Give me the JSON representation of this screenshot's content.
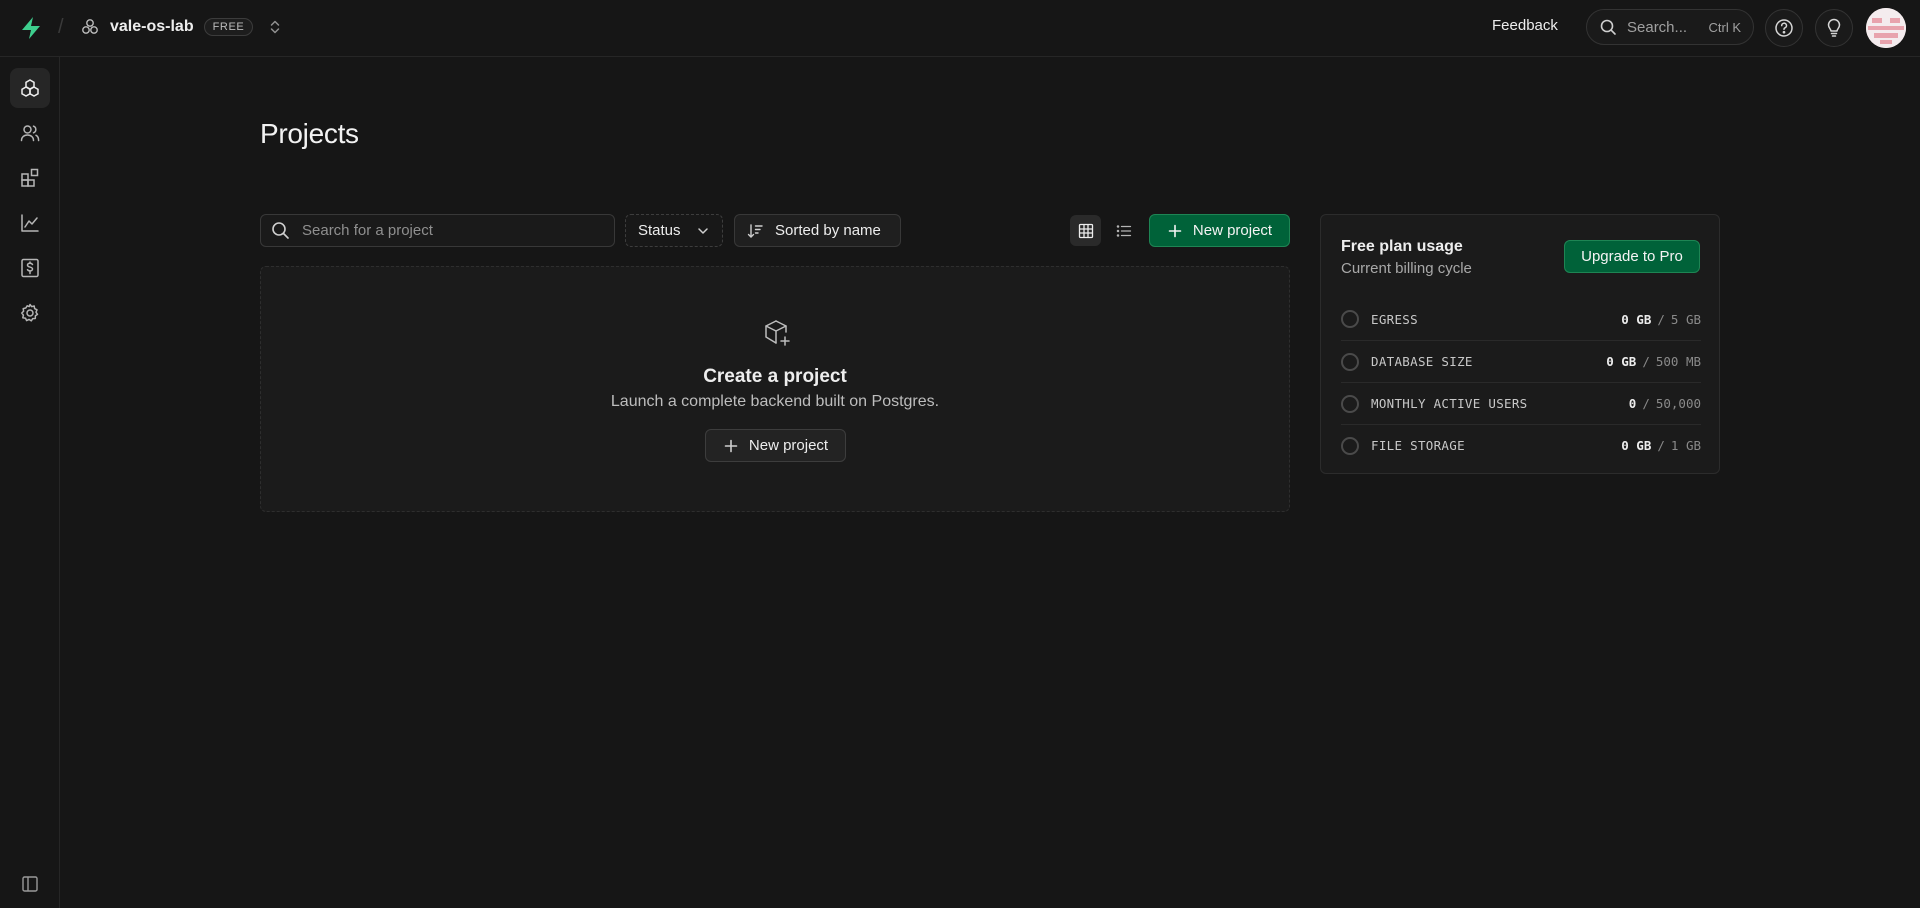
{
  "header": {
    "org_name": "vale-os-lab",
    "plan_badge": "FREE",
    "feedback_label": "Feedback",
    "search_placeholder": "Search...",
    "search_shortcut": "Ctrl K"
  },
  "sidebar": {
    "items": [
      {
        "icon": "projects-icon",
        "active": true
      },
      {
        "icon": "team-icon",
        "active": false
      },
      {
        "icon": "integrations-icon",
        "active": false
      },
      {
        "icon": "usage-chart-icon",
        "active": false
      },
      {
        "icon": "billing-icon",
        "active": false
      },
      {
        "icon": "settings-icon",
        "active": false
      }
    ]
  },
  "main": {
    "title": "Projects",
    "search_placeholder": "Search for a project",
    "status_label": "Status",
    "sort_label": "Sorted by name",
    "new_project_label": "New project",
    "empty": {
      "title": "Create a project",
      "subtitle": "Launch a complete backend built on Postgres.",
      "button_label": "New project"
    }
  },
  "usage": {
    "title": "Free plan usage",
    "subtitle": "Current billing cycle",
    "upgrade_label": "Upgrade to Pro",
    "rows": [
      {
        "label": "EGRESS",
        "value": "0 GB",
        "limit": "5 GB"
      },
      {
        "label": "DATABASE SIZE",
        "value": "0 GB",
        "limit": "500 MB"
      },
      {
        "label": "MONTHLY ACTIVE USERS",
        "value": "0",
        "limit": "50,000"
      },
      {
        "label": "FILE STORAGE",
        "value": "0 GB",
        "limit": "1 GB"
      }
    ],
    "separator": "/"
  },
  "colors": {
    "background": "#161616",
    "brand_green": "#3ecf8e",
    "button_green": "#006239"
  }
}
